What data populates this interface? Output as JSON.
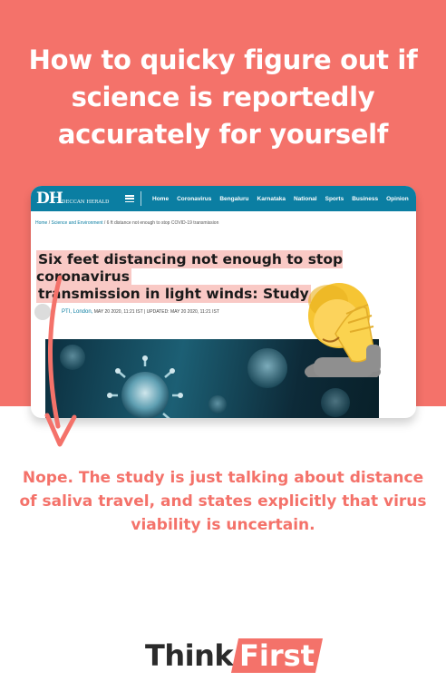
{
  "headline": "How to quicky figure out if science is reportedly accurately for yourself",
  "article": {
    "logo_mark": "DH",
    "logo_text": "DECCAN HERALD",
    "nav": [
      "Home",
      "Coronavirus",
      "Bengaluru",
      "Karnataka",
      "National",
      "Sports",
      "Business",
      "Opinion"
    ],
    "breadcrumb": {
      "home": "Home",
      "section": "Science and Environment",
      "current": "6 ft distance not enough to stop COVID-19 transmission"
    },
    "title_line1": "Six feet distancing not enough to stop coronavirus",
    "title_line2": "transmission in light winds: Study",
    "byline_author": "PTI, London,",
    "byline_dates": "MAY 20 2020, 11:21 IST | UPDATED: MAY 20 2020, 11:21 IST"
  },
  "subtext": "Nope. The study is just talking about distance of saliva travel, and states explicitly that virus viability is uncertain.",
  "brand": {
    "think": "Think",
    "first": "First"
  },
  "colors": {
    "coral": "#f4726a",
    "nav_blue": "#0b7ea2",
    "highlight": "#f9c9c5"
  },
  "icons": [
    "menu-icon",
    "facepalm-emoji",
    "curved-arrow-icon"
  ]
}
